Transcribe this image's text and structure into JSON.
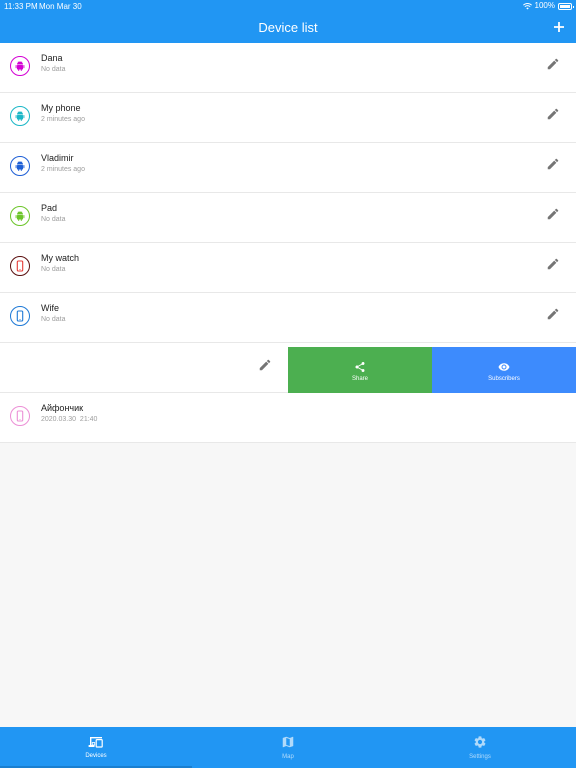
{
  "status_bar": {
    "time": "11:33 PM",
    "date": "Mon Mar 30",
    "battery": "100%"
  },
  "header": {
    "title": "Device list"
  },
  "devices": [
    {
      "name": "Dana",
      "status": "No data",
      "icon": "android-icon",
      "color": "#d400d4"
    },
    {
      "name": "My phone",
      "status": "2 minutes ago",
      "icon": "android-icon",
      "color": "#1bb7c7"
    },
    {
      "name": "Vladimir",
      "status": "2 minutes ago",
      "icon": "android-icon",
      "color": "#1e5fd6"
    },
    {
      "name": "Pad",
      "status": "No data",
      "icon": "android-icon",
      "color": "#6cc52a"
    },
    {
      "name": "My watch",
      "status": "No data",
      "icon": "phone-icon",
      "color": "#5a0f0f"
    },
    {
      "name": "Wife",
      "status": "No data",
      "icon": "phone-icon",
      "color": "#1e79d6"
    }
  ],
  "swipe_actions": {
    "share_label": "Share",
    "subscribers_label": "Subscribers"
  },
  "last_device": {
    "name": "Айфончик",
    "status": "2020.03.30  21:40",
    "icon": "phone-icon",
    "color": "#ec8fd6"
  },
  "bottom_nav": [
    {
      "label": "Devices",
      "icon": "devices-icon"
    },
    {
      "label": "Map",
      "icon": "map-icon"
    },
    {
      "label": "Settings",
      "icon": "gear-icon"
    }
  ]
}
